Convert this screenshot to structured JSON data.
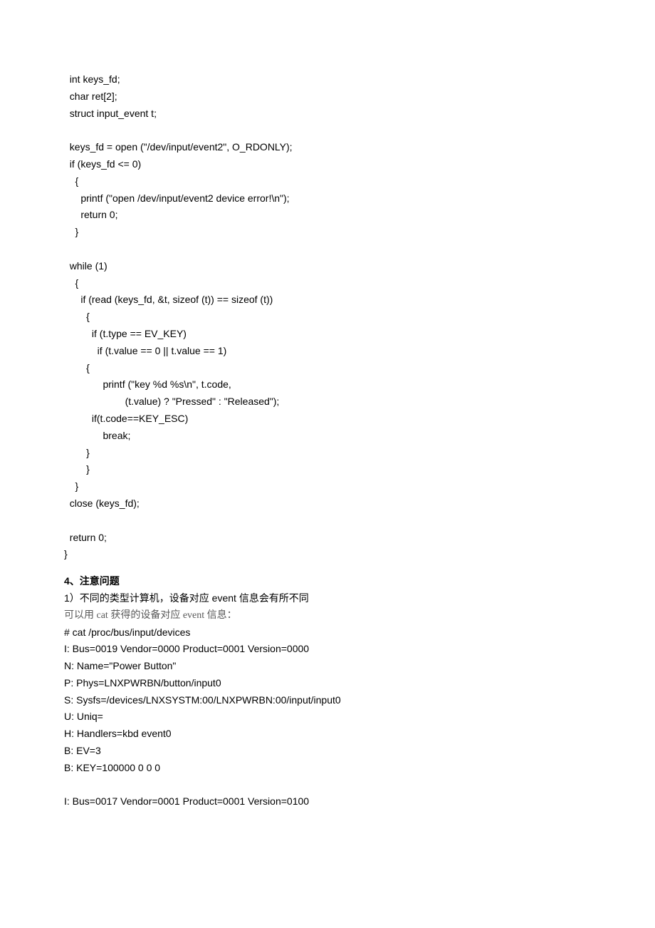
{
  "code_block": "  int keys_fd;\n  char ret[2];\n  struct input_event t;\n\n  keys_fd = open (\"/dev/input/event2\", O_RDONLY);\n  if (keys_fd <= 0)\n    {\n      printf (\"open /dev/input/event2 device error!\\n\");\n      return 0;\n    }\n\n  while (1)\n    {\n      if (read (keys_fd, &t, sizeof (t)) == sizeof (t))\n        {\n          if (t.type == EV_KEY)\n            if (t.value == 0 || t.value == 1)\n        {\n              printf (\"key %d %s\\n\", t.code,\n                      (t.value) ? \"Pressed\" : \"Released\");\n          if(t.code==KEY_ESC)\n              break;\n        }\n        }\n    }\n  close (keys_fd);\n\n  return 0;\n}",
  "section4_heading": "4、注意问题",
  "note1_prefix": "1）不同的类型计算机，设备对应 event 信息会有所不同",
  "note1_line2": "可以用 cat 获得的设备对应 event 信息：",
  "devices_block": "# cat /proc/bus/input/devices\nI: Bus=0019 Vendor=0000 Product=0001 Version=0000\nN: Name=\"Power Button\"\nP: Phys=LNXPWRBN/button/input0\nS: Sysfs=/devices/LNXSYSTM:00/LNXPWRBN:00/input/input0\nU: Uniq=\nH: Handlers=kbd event0\nB: EV=3\nB: KEY=100000 0 0 0\n\nI: Bus=0017 Vendor=0001 Product=0001 Version=0100"
}
